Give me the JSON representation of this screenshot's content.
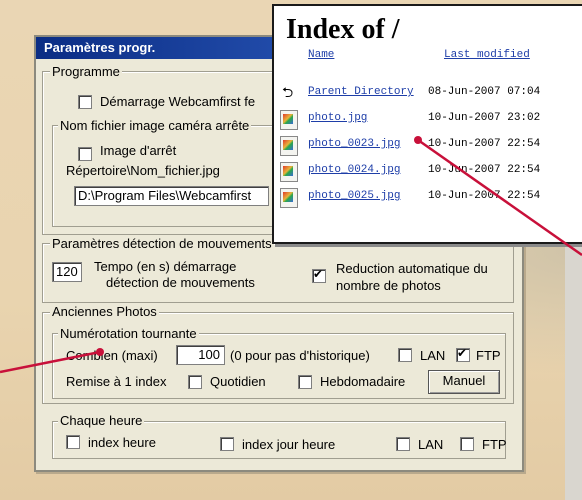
{
  "dialog": {
    "title": "Paramètres progr.",
    "programme": {
      "legend": "Programme",
      "startup_label": "Démarrage Webcamfirst fe",
      "startup_checked": false,
      "stop_image_group": "Nom fichier image caméra arrête",
      "stop_image_label": "Image d'arrêt",
      "stop_image_checked": false,
      "path_label": "Répertoire\\Nom_fichier.jpg",
      "path_value": "D:\\Program Files\\Webcamfirst"
    },
    "motion": {
      "legend": "Paramètres détection de mouvements",
      "tempo_value": "120",
      "tempo_label_1": "Tempo (en s) démarrage",
      "tempo_label_2": "détection de mouvements",
      "reduction_checked": true,
      "reduction_label_1": "Reduction automatique du",
      "reduction_label_2": "nombre de photos"
    },
    "old_photos": {
      "legend": "Anciennes Photos",
      "rotation_legend": "Numérotation tournante",
      "count_label": "Combien (maxi)",
      "count_value": "100",
      "count_hint": "(0 pour pas d'historique)",
      "lan_label": "LAN",
      "lan_checked": false,
      "ftp_label": "FTP",
      "ftp_checked": true,
      "reset_label": "Remise à 1 index",
      "daily_label": "Quotidien",
      "daily_checked": false,
      "weekly_label": "Hebdomadaire",
      "weekly_checked": false,
      "manual_button": "Manuel"
    },
    "hourly": {
      "legend": "Chaque heure",
      "index_hour_label": "index heure",
      "index_hour_checked": false,
      "index_day_hour_label": "index jour heure",
      "index_day_hour_checked": false,
      "lan_label": "LAN",
      "lan_checked": false,
      "ftp_label": "FTP",
      "ftp_checked": false
    }
  },
  "listing": {
    "title": "Index of /",
    "col_name": "Name",
    "col_modified": "Last modified",
    "rows": [
      {
        "name": "Parent Directory",
        "date": "08-Jun-2007 07:04",
        "icon": "back-arrow-icon"
      },
      {
        "name": "photo.jpg",
        "date": "10-Jun-2007 23:02",
        "icon": "image-file-icon"
      },
      {
        "name": "photo_0023.jpg",
        "date": "10-Jun-2007 22:54",
        "icon": "image-file-icon"
      },
      {
        "name": "photo_0024.jpg",
        "date": "10-Jun-2007 22:54",
        "icon": "image-file-icon"
      },
      {
        "name": "photo_0025.jpg",
        "date": "10-Jun-2007 22:54",
        "icon": "image-file-icon"
      }
    ]
  },
  "colors": {
    "title_bar": "#0b2d84",
    "callout_line": "#c8103a",
    "link": "#1e3ea8"
  }
}
